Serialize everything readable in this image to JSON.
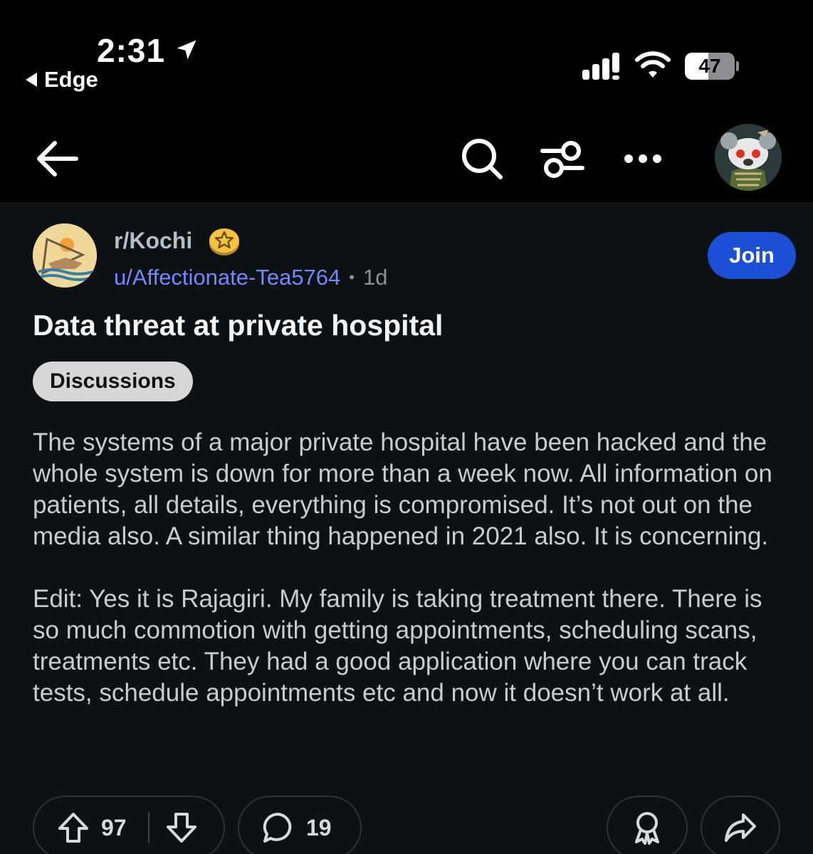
{
  "status": {
    "time": "2:31",
    "back_app": "Edge",
    "battery_level": 47,
    "battery_text": "47"
  },
  "post": {
    "subreddit": "r/Kochi",
    "author": "u/Affectionate-Tea5764",
    "age": "1d",
    "join_label": "Join",
    "title": "Data threat at private hospital",
    "flair": "Discussions",
    "paragraphs": [
      "The systems of a major private hospital have been hacked and the whole system is down for more than a week now. All information on patients, all details, everything is compromised. It’s not out on the media also. A similar thing happened in 2021 also. It is concerning.",
      "Edit: Yes it is Rajagiri. My family is taking treatment there. There is so much commotion with getting appointments, scheduling scans, treatments etc. They had a good application where you can track tests, schedule appointments etc and now it doesn’t work at all."
    ]
  },
  "actions": {
    "upvotes": "97",
    "comments": "19"
  },
  "icons": {
    "back": "arrow-left-icon",
    "search": "search-icon",
    "filter": "sliders-icon",
    "more": "more-horizontal-icon",
    "upvote": "upvote-icon",
    "downvote": "downvote-icon",
    "comment": "comment-bubble-icon",
    "award": "award-icon",
    "share": "share-arrow-icon"
  },
  "colors": {
    "background": "#0e1113",
    "join_button": "#1a4fd6",
    "author_link": "#7288ff",
    "flair_bg": "#d7d7d7"
  }
}
